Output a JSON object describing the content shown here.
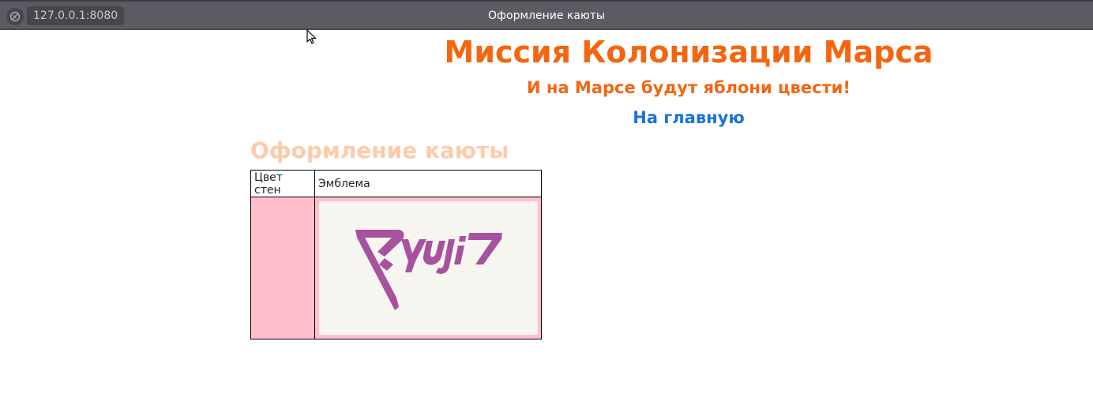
{
  "browser": {
    "url": "127.0.0.1:8080",
    "window_title": "Оформление каюты"
  },
  "header": {
    "title": "Миссия Колонизации Марса",
    "subtitle": "И на Марсе будут яблони цвести!",
    "home_link": "На главную"
  },
  "section": {
    "title": "Оформление каюты"
  },
  "table": {
    "headers": [
      "Цвет стен",
      "Эмблема"
    ],
    "wall_color": "#ffc0cb",
    "emblem_name": "Ryuji logo"
  },
  "colors": {
    "accent": "#f4650f",
    "link": "#1a73d9",
    "section_title": "#fdcbaa",
    "emblem_logo": "#a6529e"
  }
}
